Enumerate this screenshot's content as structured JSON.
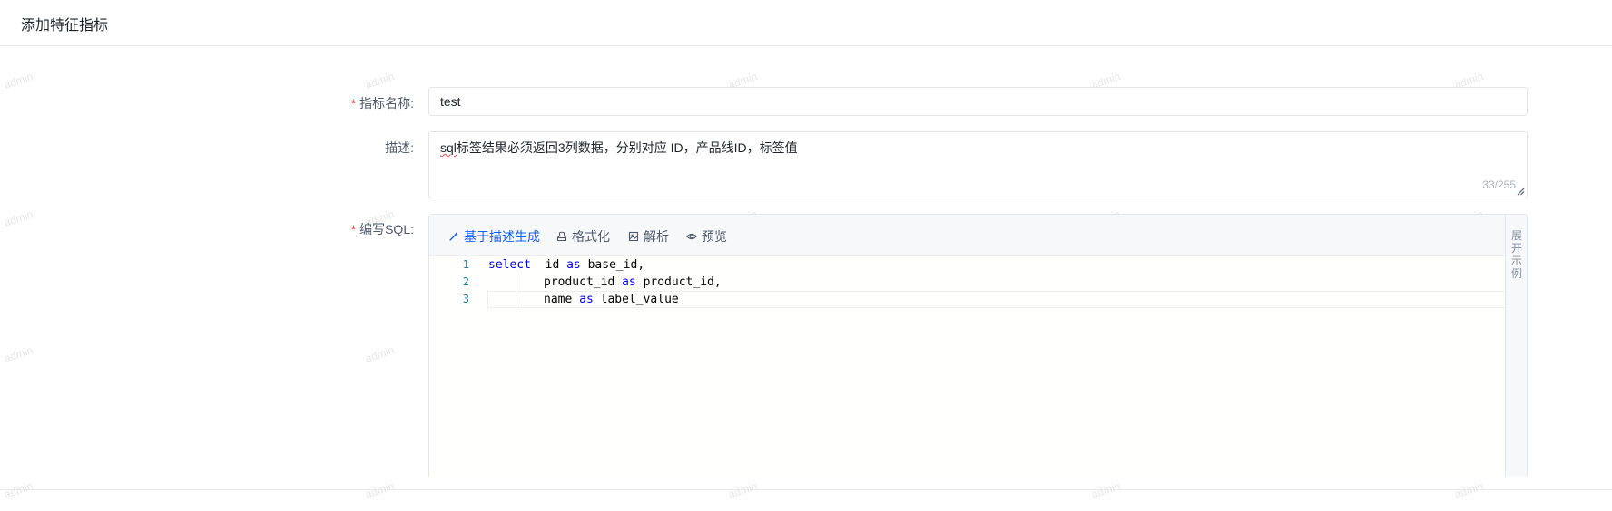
{
  "header": {
    "title": "添加特征指标"
  },
  "watermark": {
    "text": "admin"
  },
  "form": {
    "name": {
      "required_mark": "*",
      "label": "指标名称:",
      "value": "test"
    },
    "description": {
      "label": "描述:",
      "value_prefix": "sql",
      "value_rest": "标签结果必须返回3列数据，分别对应 ID，产品线ID，标签值",
      "counter": "33/255"
    },
    "sql": {
      "required_mark": "*",
      "label": "编写SQL:",
      "toolbar": {
        "generate": "基于描述生成",
        "format": "格式化",
        "parse": "解析",
        "preview": "预览"
      },
      "side_panel": "展开示例",
      "lines": [
        {
          "no": "1",
          "kw1": "select",
          "text1": "  id ",
          "kw2": "as",
          "text2": " base_id,"
        },
        {
          "no": "2",
          "kw1": "",
          "text1": "product_id ",
          "kw2": "as",
          "text2": " product_id,"
        },
        {
          "no": "3",
          "kw1": "",
          "text1": "name ",
          "kw2": "as",
          "text2": " label_value"
        }
      ]
    }
  },
  "colors": {
    "primary": "#165dff",
    "required": "#f53f3f",
    "keyword": "#0000ff",
    "line_number": "#237893"
  },
  "icons": {
    "generate": "magic-wand-icon",
    "format": "format-brush-icon",
    "parse": "parse-image-icon",
    "preview": "eye-icon"
  }
}
